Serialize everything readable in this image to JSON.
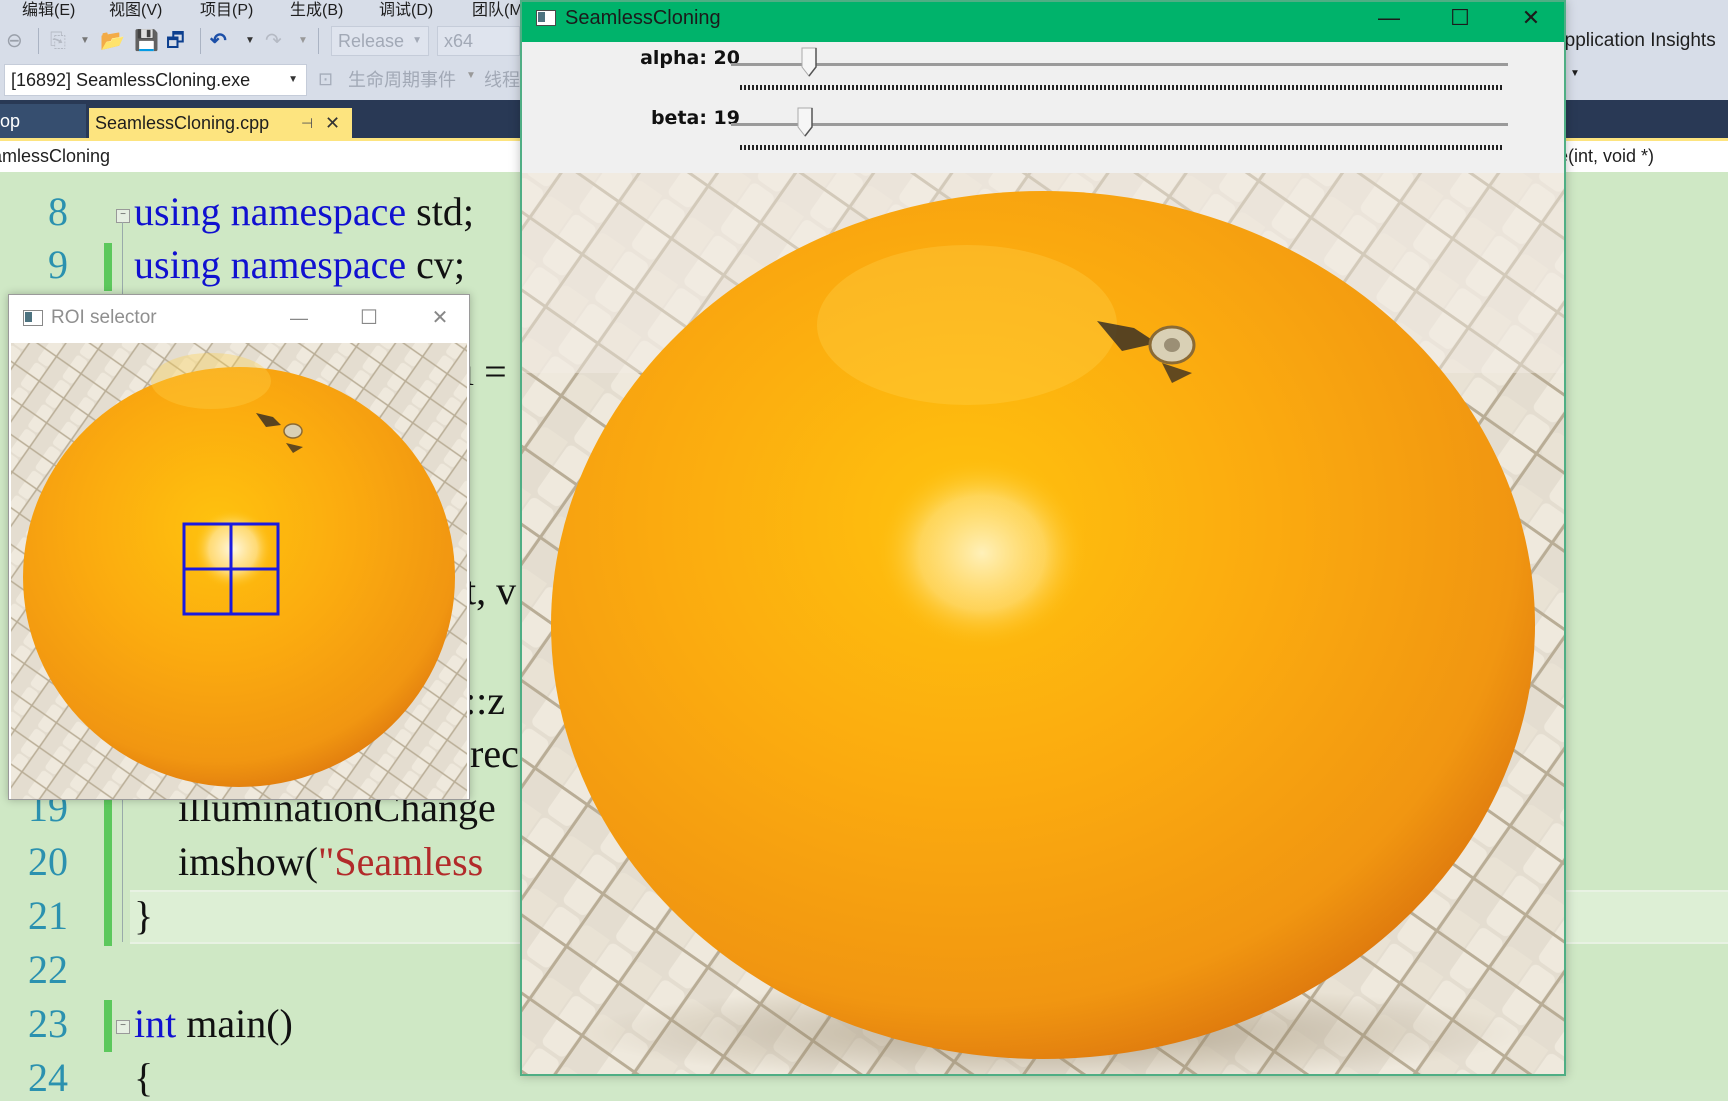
{
  "ide": {
    "menu": [
      "编辑(E)",
      "视图(V)",
      "项目(P)",
      "生成(B)",
      "调试(D)",
      "团队(M)"
    ],
    "toolbar": {
      "configuration": "Release",
      "platform": "x64",
      "process": "[16892] SeamlessCloning.exe",
      "lifecycle_events": "生命周期事件",
      "thread_label": "线程",
      "app_insights": "Application Insights"
    },
    "tabs": [
      {
        "label": "op",
        "active": false
      },
      {
        "label": "SeamlessCloning.cpp",
        "active": true
      }
    ],
    "nav": {
      "scope": "SeamlessCloning",
      "member": "e(int, void *)"
    },
    "code_lines": [
      {
        "num": "8",
        "parts": [
          {
            "t": "using namespace ",
            "k": "kw"
          },
          {
            "t": "std;",
            "k": ""
          }
        ]
      },
      {
        "num": "9",
        "parts": [
          {
            "t": "using namespace ",
            "k": "kw"
          },
          {
            "t": "cv;",
            "k": ""
          }
        ]
      },
      {
        "num": "19",
        "parts": [
          {
            "t": "illuminationChange",
            "k": ""
          }
        ]
      },
      {
        "num": "20",
        "parts": [
          {
            "t": "imshow(",
            "k": ""
          },
          {
            "t": "\"Seamless",
            "k": "str"
          }
        ]
      },
      {
        "num": "21",
        "parts": [
          {
            "t": "}",
            "k": ""
          }
        ]
      },
      {
        "num": "22",
        "parts": []
      },
      {
        "num": "23",
        "parts": [
          {
            "t": "int",
            "k": "kw"
          },
          {
            "t": " main()",
            "k": ""
          }
        ]
      },
      {
        "num": "24",
        "parts": [
          {
            "t": "{",
            "k": ""
          }
        ]
      }
    ],
    "hidden_fragments": [
      "ı =",
      "t, v",
      "::z",
      "rec"
    ]
  },
  "seamless_window": {
    "title": "SeamlessCloning",
    "trackbars": [
      {
        "name": "alpha",
        "label": "alpha: 20",
        "value": 20,
        "max": 200
      },
      {
        "name": "beta",
        "label": "beta: 19",
        "value": 19,
        "max": 200
      }
    ],
    "image_description": "orange on woven mat with illumination-changed patch"
  },
  "roi_window": {
    "title": "ROI selector",
    "selection_color": "#1a1ae0",
    "image_description": "orange on woven mat with blue ROI rectangle and crosshair"
  },
  "colors": {
    "title_active": "#00b36b",
    "editor_bg": "#cfe8c5",
    "tab_active": "#fde47f",
    "tabstrip": "#293955",
    "keyword": "#1010d0",
    "string": "#b22a2a",
    "line_number": "#2b91af"
  },
  "icons": {
    "window_minimize": "minimize-icon",
    "window_maximize": "maximize-icon",
    "window_close": "close-icon"
  }
}
